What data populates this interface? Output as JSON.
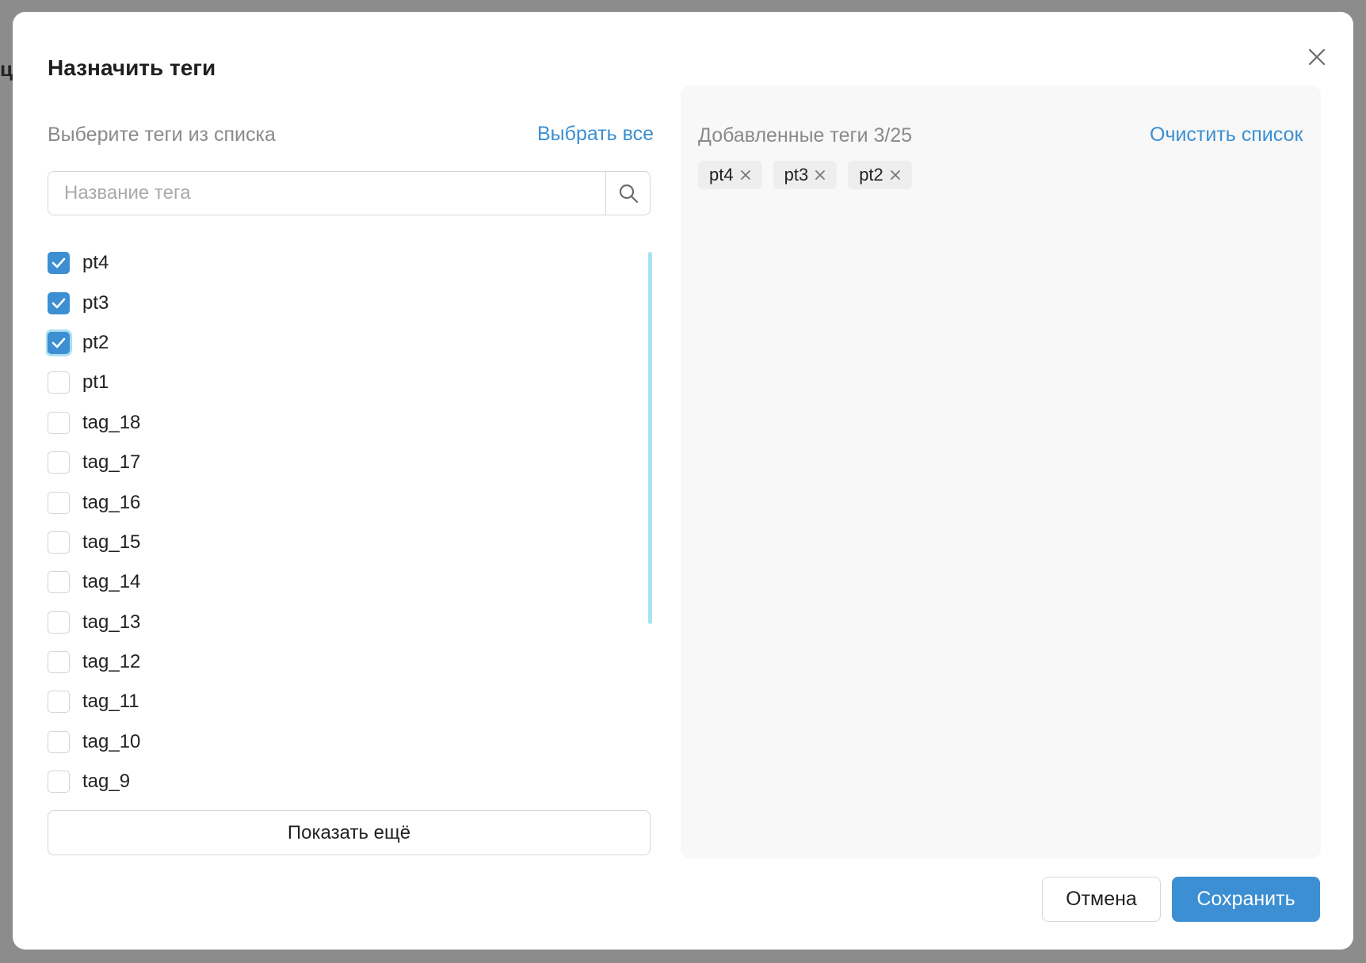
{
  "background": {
    "fragment": "ци"
  },
  "dialog": {
    "title": "Назначить теги",
    "left": {
      "label": "Выберите теги из списка",
      "select_all": "Выбрать все",
      "search_placeholder": "Название тега",
      "tags": [
        {
          "name": "pt4",
          "checked": true
        },
        {
          "name": "pt3",
          "checked": true
        },
        {
          "name": "pt2",
          "checked": true
        },
        {
          "name": "pt1",
          "checked": false
        },
        {
          "name": "tag_18",
          "checked": false
        },
        {
          "name": "tag_17",
          "checked": false
        },
        {
          "name": "tag_16",
          "checked": false
        },
        {
          "name": "tag_15",
          "checked": false
        },
        {
          "name": "tag_14",
          "checked": false
        },
        {
          "name": "tag_13",
          "checked": false
        },
        {
          "name": "tag_12",
          "checked": false
        },
        {
          "name": "tag_11",
          "checked": false
        },
        {
          "name": "tag_10",
          "checked": false
        },
        {
          "name": "tag_9",
          "checked": false
        }
      ],
      "show_more": "Показать ещё"
    },
    "right": {
      "label": "Добавленные теги 3/25",
      "clear": "Очистить список",
      "chips": [
        "pt4",
        "pt3",
        "pt2"
      ]
    },
    "cancel": "Отмена",
    "save": "Сохранить"
  },
  "colors": {
    "accent": "#3b8fd2",
    "scroll_thumb": "#a7e3f0",
    "panel_bg": "#f8f8f8"
  },
  "icons": {
    "close": "close-icon",
    "search": "search-icon",
    "check": "check-icon",
    "chip_remove": "x-icon"
  }
}
